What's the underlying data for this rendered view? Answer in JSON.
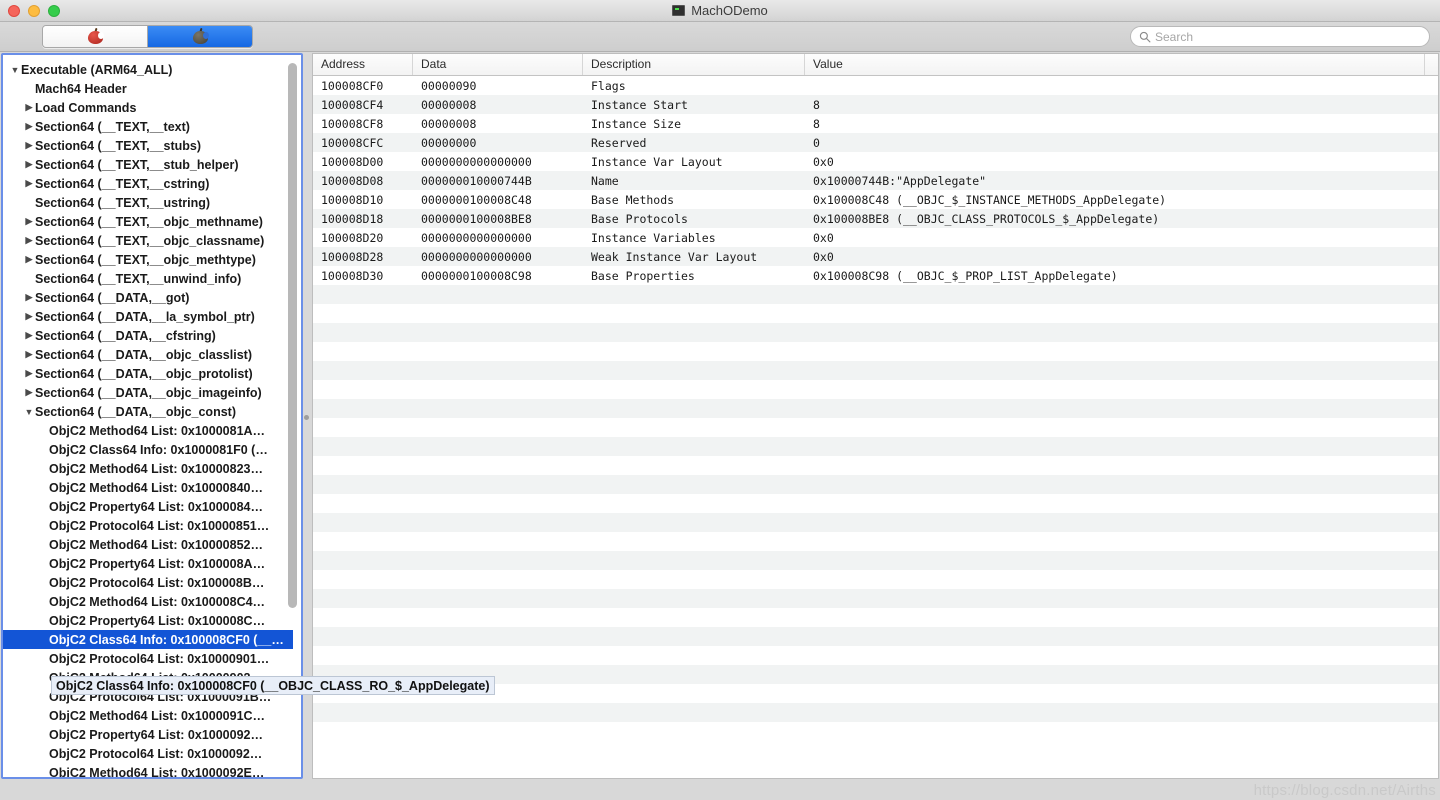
{
  "window": {
    "title": "MachODemo",
    "app_icon": "terminal-icon",
    "traffic_lights": [
      "close",
      "minimize",
      "zoom"
    ]
  },
  "toolbar": {
    "segmented": [
      {
        "label": "",
        "icon": "red-apple-icon",
        "selected": false
      },
      {
        "label": "",
        "icon": "dark-apple-icon",
        "selected": true
      }
    ],
    "search": {
      "placeholder": "Search",
      "value": "",
      "icon": "search-icon"
    }
  },
  "sidebar": {
    "items": [
      {
        "label": "Executable  (ARM64_ALL)",
        "indent": 0,
        "twisty": "down",
        "selected": false
      },
      {
        "label": "Mach64 Header",
        "indent": 1,
        "twisty": "none",
        "selected": false
      },
      {
        "label": "Load Commands",
        "indent": 1,
        "twisty": "right",
        "selected": false
      },
      {
        "label": "Section64 (__TEXT,__text)",
        "indent": 1,
        "twisty": "right",
        "selected": false
      },
      {
        "label": "Section64 (__TEXT,__stubs)",
        "indent": 1,
        "twisty": "right",
        "selected": false
      },
      {
        "label": "Section64 (__TEXT,__stub_helper)",
        "indent": 1,
        "twisty": "right",
        "selected": false
      },
      {
        "label": "Section64 (__TEXT,__cstring)",
        "indent": 1,
        "twisty": "right",
        "selected": false
      },
      {
        "label": "Section64 (__TEXT,__ustring)",
        "indent": 1,
        "twisty": "none",
        "selected": false
      },
      {
        "label": "Section64 (__TEXT,__objc_methname)",
        "indent": 1,
        "twisty": "right",
        "selected": false
      },
      {
        "label": "Section64 (__TEXT,__objc_classname)",
        "indent": 1,
        "twisty": "right",
        "selected": false
      },
      {
        "label": "Section64 (__TEXT,__objc_methtype)",
        "indent": 1,
        "twisty": "right",
        "selected": false
      },
      {
        "label": "Section64 (__TEXT,__unwind_info)",
        "indent": 1,
        "twisty": "none",
        "selected": false
      },
      {
        "label": "Section64 (__DATA,__got)",
        "indent": 1,
        "twisty": "right",
        "selected": false
      },
      {
        "label": "Section64 (__DATA,__la_symbol_ptr)",
        "indent": 1,
        "twisty": "right",
        "selected": false
      },
      {
        "label": "Section64 (__DATA,__cfstring)",
        "indent": 1,
        "twisty": "right",
        "selected": false
      },
      {
        "label": "Section64 (__DATA,__objc_classlist)",
        "indent": 1,
        "twisty": "right",
        "selected": false
      },
      {
        "label": "Section64 (__DATA,__objc_protolist)",
        "indent": 1,
        "twisty": "right",
        "selected": false
      },
      {
        "label": "Section64 (__DATA,__objc_imageinfo)",
        "indent": 1,
        "twisty": "right",
        "selected": false
      },
      {
        "label": "Section64 (__DATA,__objc_const)",
        "indent": 1,
        "twisty": "down",
        "selected": false
      },
      {
        "label": "ObjC2 Method64 List: 0x1000081A…",
        "indent": 2,
        "twisty": "none",
        "selected": false
      },
      {
        "label": "ObjC2 Class64 Info: 0x1000081F0 (…",
        "indent": 2,
        "twisty": "none",
        "selected": false
      },
      {
        "label": "ObjC2 Method64 List: 0x10000823…",
        "indent": 2,
        "twisty": "none",
        "selected": false
      },
      {
        "label": "ObjC2 Method64 List: 0x10000840…",
        "indent": 2,
        "twisty": "none",
        "selected": false
      },
      {
        "label": "ObjC2 Property64 List: 0x1000084…",
        "indent": 2,
        "twisty": "none",
        "selected": false
      },
      {
        "label": "ObjC2 Protocol64 List: 0x10000851…",
        "indent": 2,
        "twisty": "none",
        "selected": false
      },
      {
        "label": "ObjC2 Method64 List: 0x10000852…",
        "indent": 2,
        "twisty": "none",
        "selected": false
      },
      {
        "label": "ObjC2 Property64 List: 0x100008A…",
        "indent": 2,
        "twisty": "none",
        "selected": false
      },
      {
        "label": "ObjC2 Protocol64 List: 0x100008B…",
        "indent": 2,
        "twisty": "none",
        "selected": false
      },
      {
        "label": "ObjC2 Method64 List: 0x100008C4…",
        "indent": 2,
        "twisty": "none",
        "selected": false
      },
      {
        "label": "ObjC2 Property64 List: 0x100008C…",
        "indent": 2,
        "twisty": "none",
        "selected": false
      },
      {
        "label": "ObjC2 Class64 Info: 0x100008CF0 (__OBJC_CLASS_RO_$_AppDelegate)",
        "indent": 2,
        "twisty": "none",
        "selected": true
      },
      {
        "label": "ObjC2 Protocol64 List: 0x10000901…",
        "indent": 2,
        "twisty": "none",
        "selected": false
      },
      {
        "label": "ObjC2 Method64 List: 0x10000902…",
        "indent": 2,
        "twisty": "none",
        "selected": false
      },
      {
        "label": "ObjC2 Protocol64 List: 0x1000091B…",
        "indent": 2,
        "twisty": "none",
        "selected": false
      },
      {
        "label": "ObjC2 Method64 List: 0x1000091C…",
        "indent": 2,
        "twisty": "none",
        "selected": false
      },
      {
        "label": "ObjC2 Property64 List: 0x1000092…",
        "indent": 2,
        "twisty": "none",
        "selected": false
      },
      {
        "label": "ObjC2 Protocol64 List: 0x1000092…",
        "indent": 2,
        "twisty": "none",
        "selected": false
      },
      {
        "label": "ObjC2 Method64 List: 0x1000092E…",
        "indent": 2,
        "twisty": "none",
        "selected": false
      }
    ],
    "selected_tooltip": "ObjC2 Class64 Info: 0x100008CF0 (__OBJC_CLASS_RO_$_AppDelegate)"
  },
  "table": {
    "columns": [
      "Address",
      "Data",
      "Description",
      "Value"
    ],
    "rows": [
      {
        "address": "100008CF0",
        "data": "00000090",
        "description": "Flags",
        "value": ""
      },
      {
        "address": "100008CF4",
        "data": "00000008",
        "description": "Instance Start",
        "value": "8"
      },
      {
        "address": "100008CF8",
        "data": "00000008",
        "description": "Instance Size",
        "value": "8"
      },
      {
        "address": "100008CFC",
        "data": "00000000",
        "description": "Reserved",
        "value": "0"
      },
      {
        "address": "100008D00",
        "data": "0000000000000000",
        "description": "Instance Var Layout",
        "value": "0x0"
      },
      {
        "address": "100008D08",
        "data": "000000010000744B",
        "description": "Name",
        "value": "0x10000744B:\"AppDelegate\""
      },
      {
        "address": "100008D10",
        "data": "0000000100008C48",
        "description": "Base Methods",
        "value": "0x100008C48 (__OBJC_$_INSTANCE_METHODS_AppDelegate)"
      },
      {
        "address": "100008D18",
        "data": "0000000100008BE8",
        "description": "Base Protocols",
        "value": "0x100008BE8 (__OBJC_CLASS_PROTOCOLS_$_AppDelegate)"
      },
      {
        "address": "100008D20",
        "data": "0000000000000000",
        "description": "Instance Variables",
        "value": "0x0"
      },
      {
        "address": "100008D28",
        "data": "0000000000000000",
        "description": "Weak Instance Var Layout",
        "value": "0x0"
      },
      {
        "address": "100008D30",
        "data": "0000000100008C98",
        "description": "Base Properties",
        "value": "0x100008C98 (__OBJC_$_PROP_LIST_AppDelegate)"
      }
    ],
    "empty_row_count": 24
  },
  "watermark": "https://blog.csdn.net/Airths",
  "colors": {
    "selection_blue": "#1355d6",
    "focus_border": "#6a8fe8",
    "row_stripe": "#f1f3f3",
    "segment_active": "#2f7ced"
  }
}
